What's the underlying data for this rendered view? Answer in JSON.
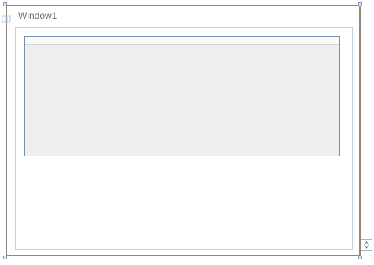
{
  "window": {
    "title": "Window1"
  },
  "icons": {
    "edge_marker": "grid-marker-icon",
    "adorner": "crosshair-icon"
  },
  "colors": {
    "frame_border": "#8f8781",
    "grid_border": "#7890b3",
    "grid_fill": "#efefef",
    "handle_fill": "#dce7f4"
  }
}
